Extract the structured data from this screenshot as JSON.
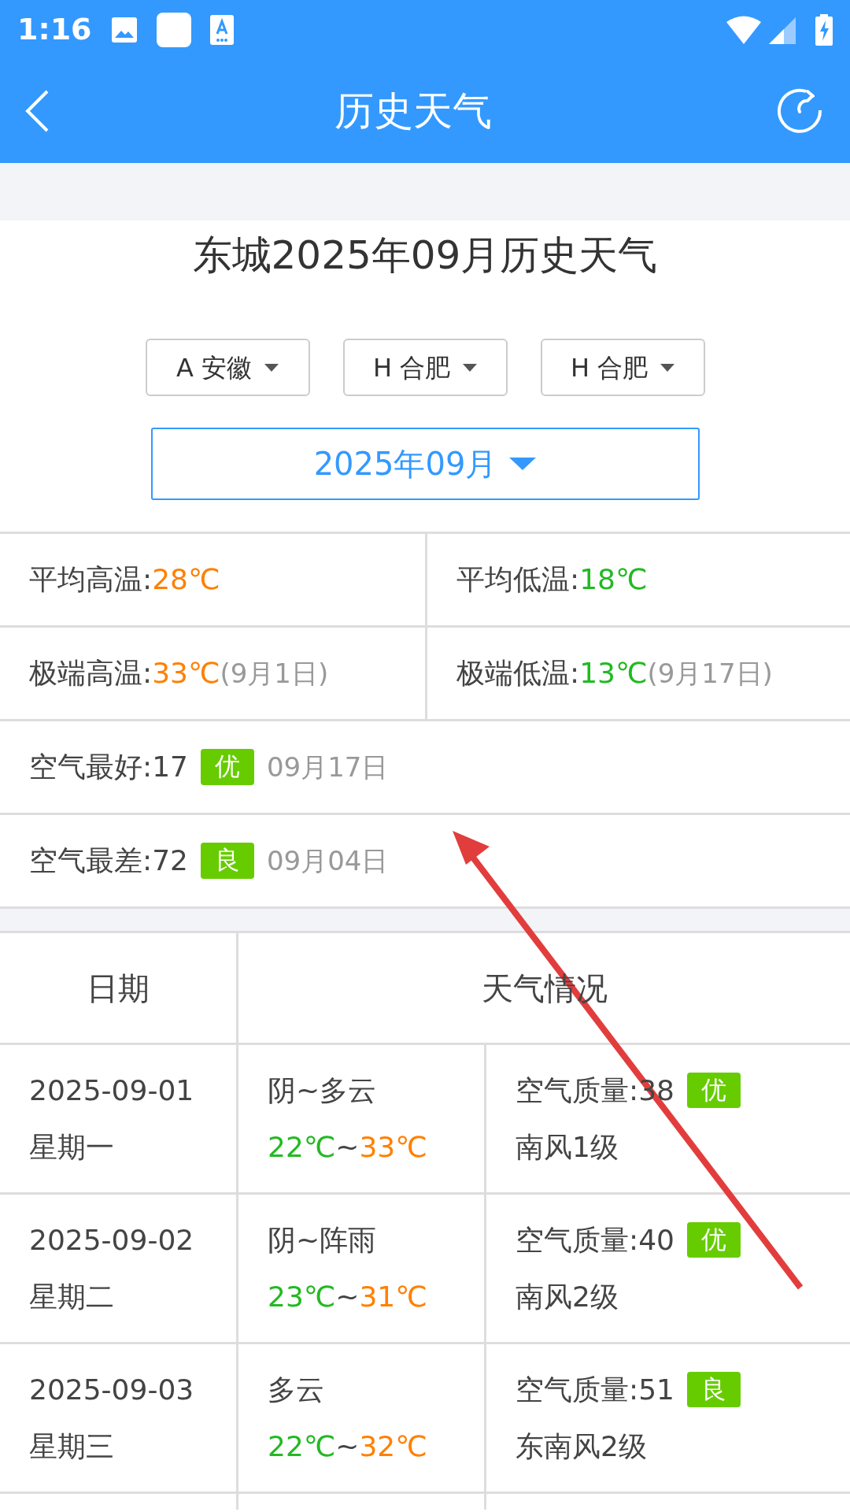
{
  "status_bar": {
    "time": "1:16"
  },
  "app_bar": {
    "title": "历史天气"
  },
  "heading": "东城2025年09月历史天气",
  "selectors": [
    {
      "label": "A 安徽"
    },
    {
      "label": "H 合肥"
    },
    {
      "label": "H 合肥"
    }
  ],
  "month_picker": {
    "value": "2025年09月"
  },
  "summary": [
    [
      {
        "label": "平均高温:",
        "value": "28℃",
        "kind": "high"
      },
      {
        "label": "平均低温:",
        "value": "18℃",
        "kind": "low"
      }
    ],
    [
      {
        "label": "极端高温:",
        "value": "33℃",
        "kind": "high",
        "note": "(9月1日)"
      },
      {
        "label": "极端低温:",
        "value": "13℃",
        "kind": "low",
        "note": "(9月17日)"
      }
    ]
  ],
  "air": [
    {
      "label": "空气最好:17",
      "badge": "优",
      "date": "09月17日"
    },
    {
      "label": "空气最差:72",
      "badge": "良",
      "date": "09月04日"
    }
  ],
  "table": {
    "columns": [
      "日期",
      "天气情况"
    ],
    "rows": [
      {
        "date": "2025-09-01",
        "weekday": "星期一",
        "weather": "阴~多云",
        "low": "22℃",
        "sep": "~",
        "high": "33℃",
        "aqi": "空气质量:38",
        "badge": "优",
        "wind": "南风1级"
      },
      {
        "date": "2025-09-02",
        "weekday": "星期二",
        "weather": "阴~阵雨",
        "low": "23℃",
        "sep": "~",
        "high": "31℃",
        "aqi": "空气质量:40",
        "badge": "优",
        "wind": "南风2级"
      },
      {
        "date": "2025-09-03",
        "weekday": "星期三",
        "weather": "多云",
        "low": "22℃",
        "sep": "~",
        "high": "32℃",
        "aqi": "空气质量:51",
        "badge": "良",
        "wind": "东南风2级"
      }
    ]
  }
}
